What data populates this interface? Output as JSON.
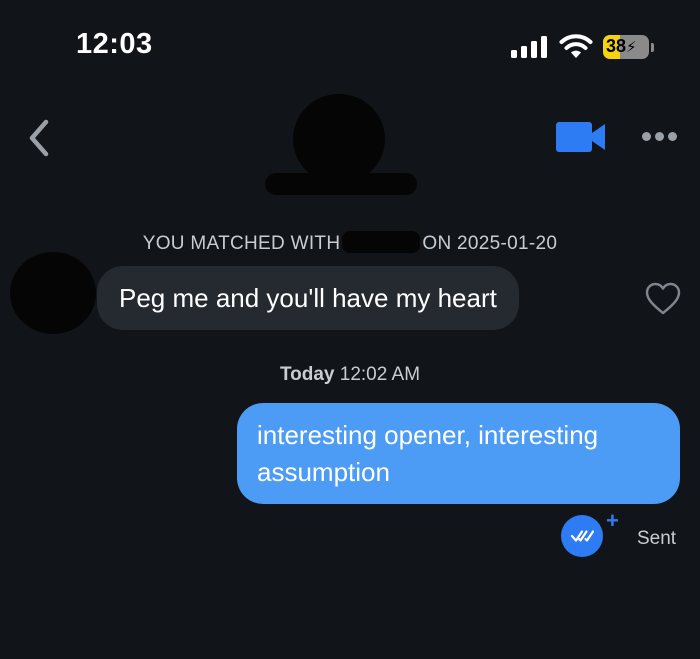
{
  "status_bar": {
    "time": "12:03",
    "battery_level": "38",
    "battery_fraction": 0.38
  },
  "header": {
    "back_icon": "chevron-left-icon",
    "video_icon": "video-camera-icon",
    "more_icon": "more-horizontal-icon"
  },
  "conversation": {
    "match_prefix": "YOU MATCHED WITH",
    "match_suffix": "ON 2025-01-20",
    "incoming": {
      "text": "Peg me and you'll have my heart"
    },
    "timestamp_day": "Today",
    "timestamp_time": "12:02 AM",
    "outgoing": {
      "text": "interesting opener, interesting assumption"
    },
    "status": "Sent"
  },
  "colors": {
    "background": "#111418",
    "incoming_bubble": "#252a31",
    "outgoing_bubble": "#4c9bf5",
    "accent": "#2d7cf3",
    "battery": "#f5d30f"
  }
}
